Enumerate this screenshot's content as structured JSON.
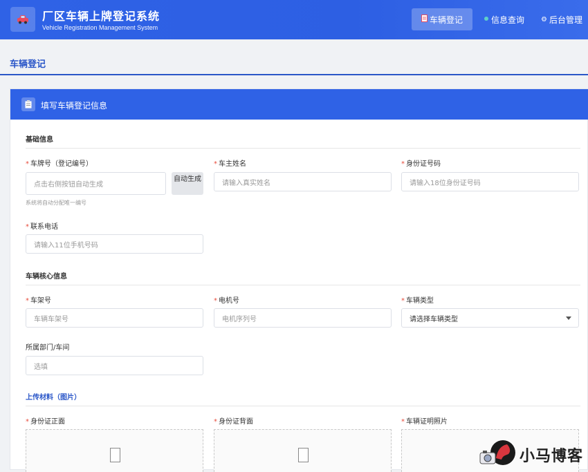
{
  "header": {
    "title": "厂区车辆上牌登记系统",
    "subtitle": "Vehicle Registration Management System",
    "logo_icon": "car-icon",
    "nav": [
      {
        "label": "车辆登记",
        "icon": "document-icon"
      },
      {
        "label": "信息查询",
        "icon": "search-dot-icon"
      },
      {
        "label": "后台管理",
        "icon": "gear-icon"
      }
    ]
  },
  "page": {
    "title": "车辆登记"
  },
  "form": {
    "card_title": "填写车辆登记信息",
    "sections": {
      "basic": "基础信息",
      "core": "车辆核心信息",
      "upload": "上传材料（图片）"
    },
    "required_mark": "*",
    "fields": {
      "plate": {
        "label": "车牌号（登记编号）",
        "placeholder": "点击右侧按钮自动生成",
        "hint": "系统将自动分配唯一编号",
        "button": "自动生成"
      },
      "owner": {
        "label": "车主姓名",
        "placeholder": "请输入真实姓名"
      },
      "id_number": {
        "label": "身份证号码",
        "placeholder": "请输入18位身份证号码"
      },
      "phone": {
        "label": "联系电话",
        "placeholder": "请输入11位手机号码"
      },
      "frame": {
        "label": "车架号",
        "placeholder": "车辆车架号"
      },
      "engine": {
        "label": "电机号",
        "placeholder": "电机序列号"
      },
      "vehicle_type": {
        "label": "车辆类型",
        "selected": "请选择车辆类型"
      },
      "department": {
        "label": "所属部门/车间",
        "placeholder": "选填"
      }
    },
    "uploads": [
      {
        "label": "身份证正面"
      },
      {
        "label": "身份证背面"
      },
      {
        "label": "车辆证明照片"
      }
    ]
  },
  "watermark": {
    "text": "小马博客"
  },
  "colors": {
    "primary": "#2f62e6",
    "required": "#e74c3c"
  }
}
